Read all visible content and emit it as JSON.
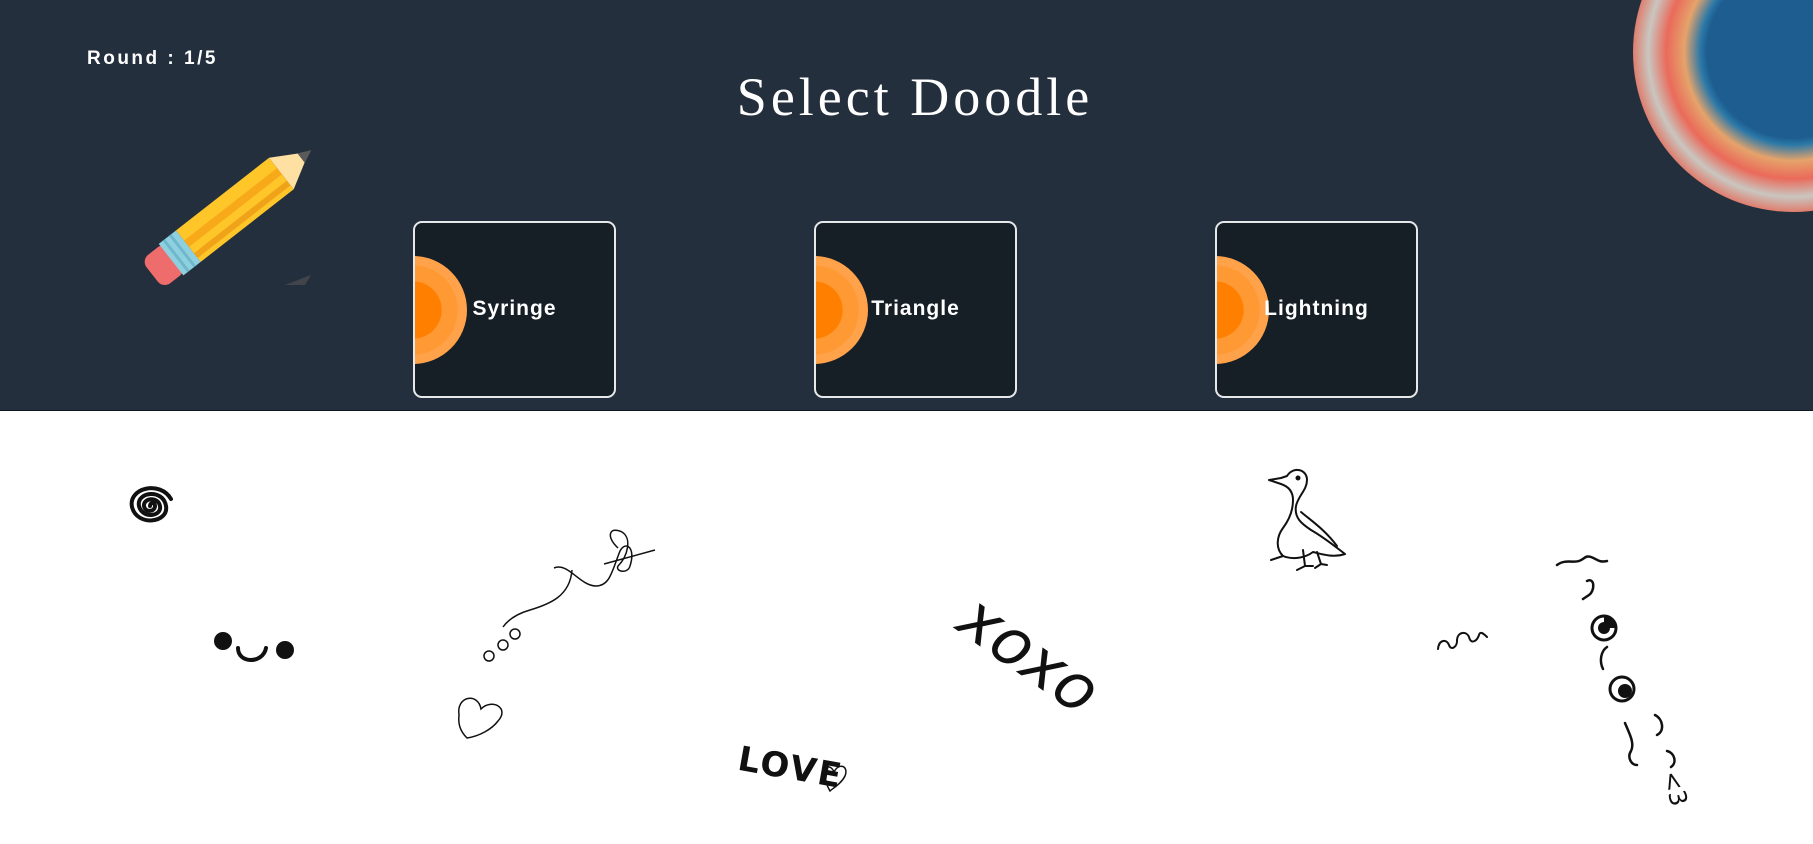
{
  "header": {
    "round_label": "Round : 1/5",
    "title": "Select Doodle"
  },
  "options": [
    {
      "label": "Syringe"
    },
    {
      "label": "Triangle"
    },
    {
      "label": "Lightning"
    }
  ],
  "icons": {
    "decor_pencil": "pencil-icon",
    "decor_rainbow": "rainbow-circle",
    "option_badge": "orange-half-circle"
  },
  "colors": {
    "header_bg": "#242f3d",
    "card_bg": "#161e26",
    "card_border": "#e6e8ea",
    "accent_orange": "#ff9933",
    "text": "#ffffff"
  },
  "doodles": {
    "love_text": "LOVE",
    "xoxo_text": "xoxo",
    "emoticon_text": "<3"
  }
}
